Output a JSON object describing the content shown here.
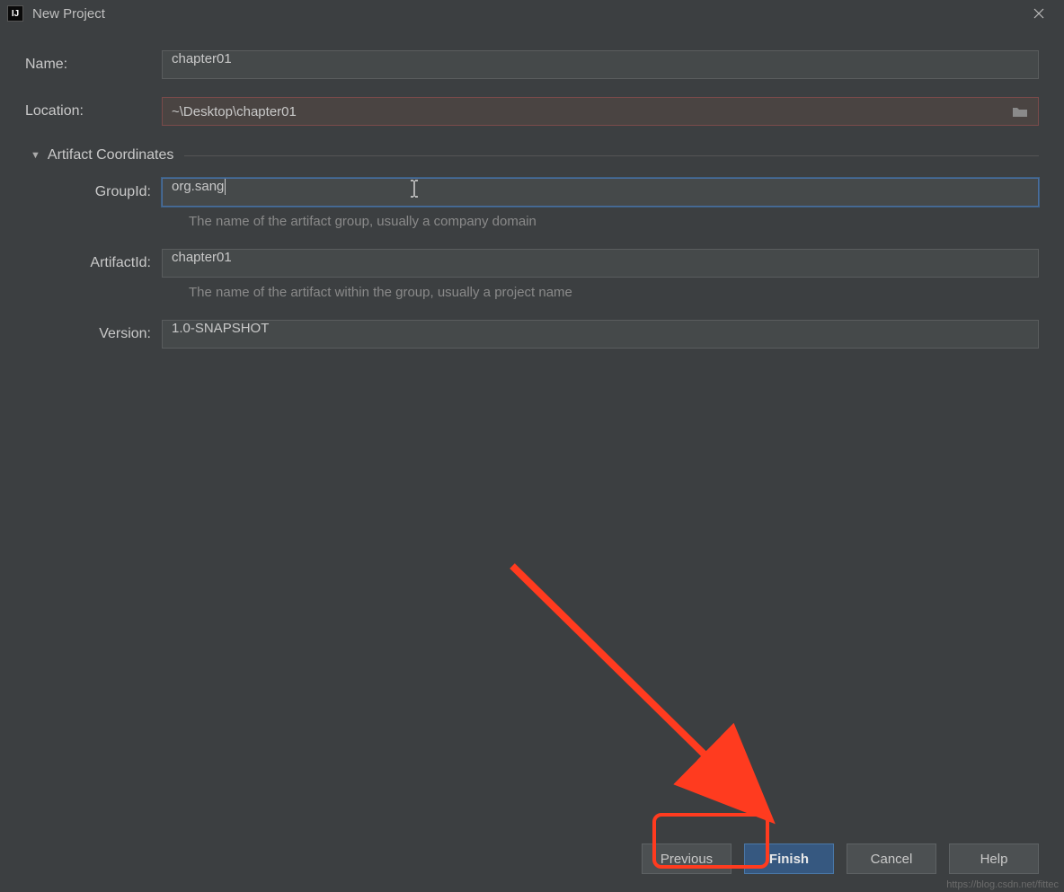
{
  "window": {
    "title": "New Project",
    "app_icon_text": "IJ"
  },
  "form": {
    "name_label": "Name:",
    "name_value": "chapter01",
    "location_label": "Location:",
    "location_value": "~\\Desktop\\chapter01"
  },
  "artifact": {
    "section_title": "Artifact Coordinates",
    "groupid_label": "GroupId:",
    "groupid_value": "org.sang",
    "groupid_hint": "The name of the artifact group, usually a company domain",
    "artifactid_label": "ArtifactId:",
    "artifactid_value": "chapter01",
    "artifactid_hint": "The name of the artifact within the group, usually a project name",
    "version_label": "Version:",
    "version_value": "1.0-SNAPSHOT"
  },
  "buttons": {
    "previous": "Previous",
    "finish": "Finish",
    "cancel": "Cancel",
    "help": "Help"
  },
  "watermark": "https://blog.csdn.net/fittec"
}
